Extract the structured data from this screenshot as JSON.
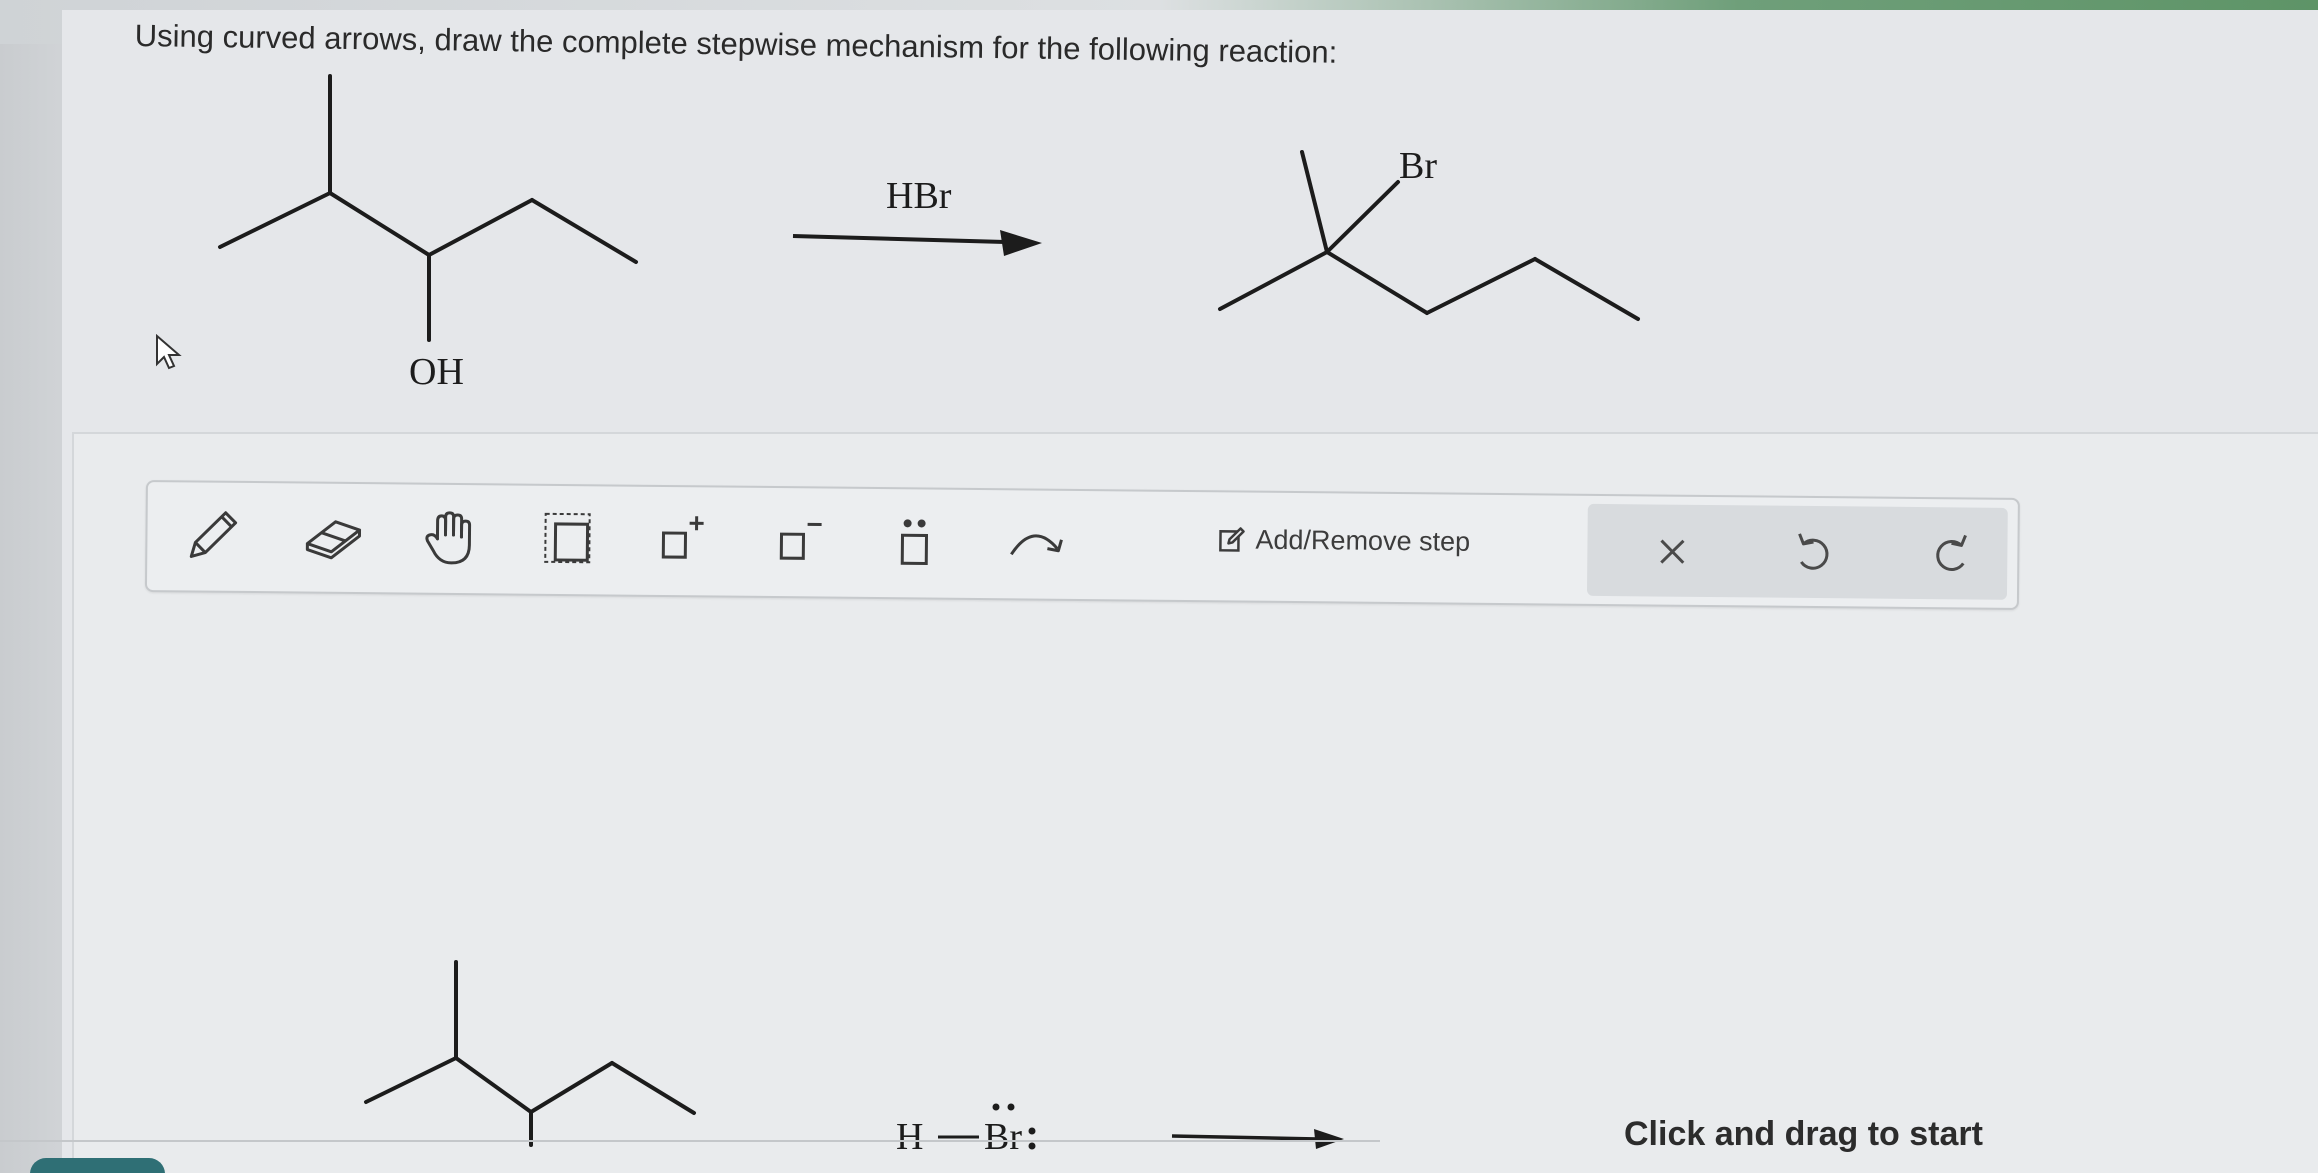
{
  "question": {
    "text": "Using curved arrows, draw the complete stepwise mechanism for the following reaction:"
  },
  "reaction": {
    "reactant": {
      "substituent_label": "OH"
    },
    "reagent": "HBr",
    "product": {
      "substituent_label": "Br"
    }
  },
  "toolbar": {
    "tools": [
      {
        "name": "pencil-tool",
        "icon": "pencil-icon"
      },
      {
        "name": "eraser-tool",
        "icon": "eraser-icon"
      },
      {
        "name": "hand-tool",
        "icon": "hand-icon"
      },
      {
        "name": "select-tool",
        "icon": "dashed-select-icon"
      },
      {
        "name": "positive-charge-tool",
        "icon": "box-plus-icon"
      },
      {
        "name": "negative-charge-tool",
        "icon": "box-minus-icon"
      },
      {
        "name": "lone-pair-tool",
        "icon": "box-dots-icon"
      },
      {
        "name": "curved-arrow-tool",
        "icon": "curved-arrow-icon"
      }
    ],
    "add_remove_step_label": "Add/Remove step",
    "actions": [
      {
        "name": "clear-button",
        "icon": "close-icon"
      },
      {
        "name": "undo-button",
        "icon": "undo-icon"
      },
      {
        "name": "redo-button",
        "icon": "redo-icon"
      }
    ]
  },
  "canvas": {
    "reagent_text_h": "H",
    "reagent_text_br": "Br",
    "hint_text": "Click and drag to start"
  }
}
